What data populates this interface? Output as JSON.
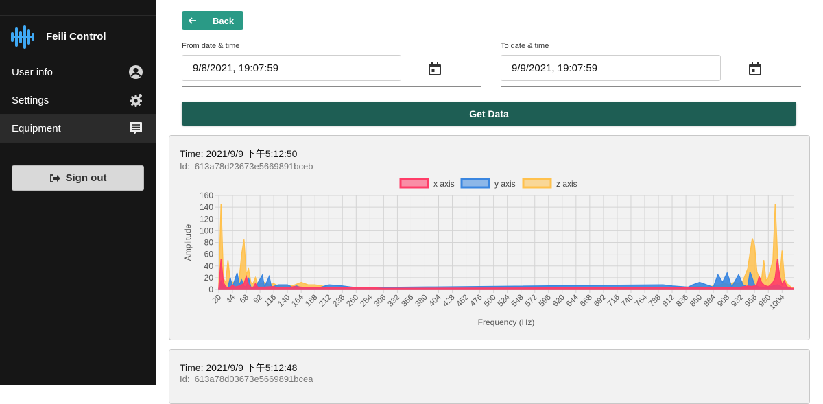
{
  "app": {
    "name": "Feili Control"
  },
  "sidebar": {
    "items": [
      {
        "label": "User info",
        "icon": "user-icon"
      },
      {
        "label": "Settings",
        "icon": "gear-icon"
      },
      {
        "label": "Equipment",
        "icon": "chat-icon"
      }
    ],
    "sign_out_label": "Sign out"
  },
  "filters": {
    "back_label": "Back",
    "from_label": "From date & time",
    "from_value": "9/8/2021, 19:07:59",
    "to_label": "To date & time",
    "to_value": "9/9/2021, 19:07:59",
    "get_data_label": "Get Data"
  },
  "colors": {
    "accent": "#2a9a86",
    "primary_dark": "#1e5e54",
    "x_axis": "#ff3d68",
    "y_axis": "#3a86e0",
    "z_axis": "#ffc14d"
  },
  "records": [
    {
      "time": "Time: 2021/9/9 下午5:12:50",
      "id_label": "Id:",
      "id": "613a78d23673e5669891bceb"
    },
    {
      "time": "Time: 2021/9/9 下午5:12:48",
      "id_label": "Id:",
      "id": "613a78d03673e5669891bcea"
    }
  ],
  "chart_data": {
    "type": "area",
    "xlabel": "Frequency (Hz)",
    "ylabel": "Amplitude",
    "ylim": [
      0,
      160
    ],
    "yticks": [
      0,
      20,
      40,
      60,
      80,
      100,
      120,
      140,
      160
    ],
    "xticks": [
      20,
      44,
      68,
      92,
      116,
      140,
      164,
      188,
      212,
      236,
      260,
      284,
      308,
      332,
      356,
      380,
      404,
      428,
      452,
      476,
      500,
      524,
      548,
      572,
      596,
      620,
      644,
      668,
      692,
      716,
      740,
      764,
      788,
      812,
      836,
      860,
      884,
      908,
      932,
      956,
      980,
      1004
    ],
    "xlim": [
      20,
      1024
    ],
    "grid": true,
    "legend_position": "top",
    "series": [
      {
        "name": "x axis",
        "color": "#ff3d68",
        "points": [
          [
            20,
            2
          ],
          [
            24,
            52
          ],
          [
            28,
            12
          ],
          [
            32,
            5
          ],
          [
            36,
            3
          ],
          [
            40,
            3
          ],
          [
            44,
            8
          ],
          [
            48,
            4
          ],
          [
            56,
            6
          ],
          [
            60,
            8
          ],
          [
            64,
            10
          ],
          [
            68,
            22
          ],
          [
            72,
            8
          ],
          [
            76,
            4
          ],
          [
            80,
            3
          ],
          [
            84,
            10
          ],
          [
            88,
            4
          ],
          [
            100,
            4
          ],
          [
            116,
            5
          ],
          [
            124,
            3
          ],
          [
            140,
            3
          ],
          [
            152,
            5
          ],
          [
            164,
            4
          ],
          [
            176,
            3
          ],
          [
            190,
            3
          ],
          [
            212,
            3
          ],
          [
            236,
            3
          ],
          [
            284,
            3
          ],
          [
            308,
            2
          ],
          [
            764,
            3
          ],
          [
            860,
            3
          ],
          [
            884,
            3
          ],
          [
            908,
            3
          ],
          [
            932,
            4
          ],
          [
            944,
            6
          ],
          [
            952,
            5
          ],
          [
            960,
            8
          ],
          [
            964,
            22
          ],
          [
            968,
            12
          ],
          [
            972,
            8
          ],
          [
            976,
            6
          ],
          [
            980,
            5
          ],
          [
            984,
            8
          ],
          [
            988,
            12
          ],
          [
            992,
            20
          ],
          [
            996,
            52
          ],
          [
            1000,
            22
          ],
          [
            1004,
            8
          ],
          [
            1008,
            15
          ],
          [
            1012,
            5
          ],
          [
            1020,
            2
          ],
          [
            1024,
            2
          ]
        ]
      },
      {
        "name": "y axis",
        "color": "#3a86e0",
        "points": [
          [
            20,
            2
          ],
          [
            24,
            14
          ],
          [
            28,
            6
          ],
          [
            36,
            3
          ],
          [
            40,
            20
          ],
          [
            44,
            4
          ],
          [
            52,
            28
          ],
          [
            56,
            8
          ],
          [
            60,
            16
          ],
          [
            64,
            6
          ],
          [
            68,
            4
          ],
          [
            72,
            20
          ],
          [
            76,
            4
          ],
          [
            84,
            4
          ],
          [
            96,
            24
          ],
          [
            100,
            4
          ],
          [
            108,
            22
          ],
          [
            112,
            4
          ],
          [
            124,
            8
          ],
          [
            140,
            8
          ],
          [
            148,
            4
          ],
          [
            156,
            6
          ],
          [
            164,
            3
          ],
          [
            196,
            3
          ],
          [
            212,
            8
          ],
          [
            236,
            6
          ],
          [
            260,
            3
          ],
          [
            796,
            8
          ],
          [
            812,
            6
          ],
          [
            840,
            4
          ],
          [
            848,
            8
          ],
          [
            860,
            12
          ],
          [
            872,
            8
          ],
          [
            884,
            4
          ],
          [
            892,
            25
          ],
          [
            900,
            12
          ],
          [
            908,
            28
          ],
          [
            916,
            4
          ],
          [
            928,
            25
          ],
          [
            936,
            8
          ],
          [
            944,
            4
          ],
          [
            948,
            30
          ],
          [
            956,
            8
          ],
          [
            964,
            4
          ],
          [
            980,
            4
          ],
          [
            988,
            6
          ],
          [
            996,
            8
          ],
          [
            1004,
            4
          ],
          [
            1012,
            3
          ],
          [
            1020,
            2
          ],
          [
            1024,
            2
          ]
        ]
      },
      {
        "name": "z axis",
        "color": "#ffc14d",
        "points": [
          [
            20,
            5
          ],
          [
            24,
            145
          ],
          [
            28,
            20
          ],
          [
            32,
            10
          ],
          [
            36,
            50
          ],
          [
            40,
            15
          ],
          [
            44,
            12
          ],
          [
            52,
            14
          ],
          [
            56,
            20
          ],
          [
            60,
            60
          ],
          [
            64,
            85
          ],
          [
            68,
            25
          ],
          [
            72,
            35
          ],
          [
            76,
            12
          ],
          [
            80,
            10
          ],
          [
            84,
            20
          ],
          [
            88,
            8
          ],
          [
            100,
            12
          ],
          [
            108,
            8
          ],
          [
            116,
            10
          ],
          [
            124,
            6
          ],
          [
            136,
            8
          ],
          [
            148,
            6
          ],
          [
            164,
            12
          ],
          [
            176,
            8
          ],
          [
            188,
            8
          ],
          [
            200,
            6
          ],
          [
            212,
            4
          ],
          [
            236,
            4
          ],
          [
            260,
            3
          ],
          [
            284,
            3
          ],
          [
            308,
            2
          ],
          [
            332,
            2
          ],
          [
            740,
            2
          ],
          [
            764,
            3
          ],
          [
            788,
            3
          ],
          [
            812,
            4
          ],
          [
            836,
            4
          ],
          [
            860,
            5
          ],
          [
            872,
            4
          ],
          [
            884,
            6
          ],
          [
            896,
            8
          ],
          [
            904,
            10
          ],
          [
            912,
            8
          ],
          [
            920,
            12
          ],
          [
            928,
            10
          ],
          [
            936,
            15
          ],
          [
            944,
            35
          ],
          [
            952,
            87
          ],
          [
            956,
            75
          ],
          [
            960,
            30
          ],
          [
            964,
            20
          ],
          [
            968,
            15
          ],
          [
            972,
            50
          ],
          [
            976,
            15
          ],
          [
            980,
            20
          ],
          [
            988,
            50
          ],
          [
            992,
            145
          ],
          [
            996,
            60
          ],
          [
            1000,
            20
          ],
          [
            1004,
            66
          ],
          [
            1008,
            20
          ],
          [
            1012,
            10
          ],
          [
            1020,
            4
          ],
          [
            1024,
            3
          ]
        ]
      }
    ]
  }
}
